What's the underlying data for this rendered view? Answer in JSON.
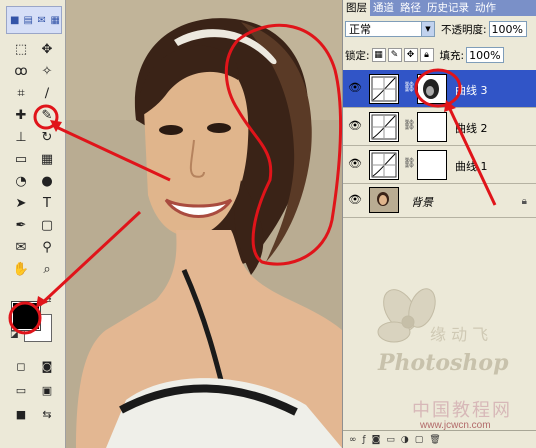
{
  "toolbar": {
    "top_icons": [
      "save-icon",
      "print-icon",
      "email-icon",
      "browse-icon"
    ],
    "tools": [
      {
        "name": "marquee-tool-icon",
        "glyph": "⬚"
      },
      {
        "name": "move-tool-icon",
        "glyph": "✥"
      },
      {
        "name": "lasso-tool-icon",
        "glyph": "ꝏ"
      },
      {
        "name": "magic-wand-tool-icon",
        "glyph": "✧"
      },
      {
        "name": "crop-tool-icon",
        "glyph": "⌗"
      },
      {
        "name": "slice-tool-icon",
        "glyph": "∕"
      },
      {
        "name": "healing-brush-tool-icon",
        "glyph": "✚"
      },
      {
        "name": "brush-tool-icon",
        "glyph": "✎"
      },
      {
        "name": "clone-stamp-tool-icon",
        "glyph": "⊥"
      },
      {
        "name": "history-brush-tool-icon",
        "glyph": "↻"
      },
      {
        "name": "eraser-tool-icon",
        "glyph": "▭"
      },
      {
        "name": "gradient-tool-icon",
        "glyph": "▦"
      },
      {
        "name": "blur-tool-icon",
        "glyph": "◔"
      },
      {
        "name": "dodge-tool-icon",
        "glyph": "●"
      },
      {
        "name": "path-selection-tool-icon",
        "glyph": "➤"
      },
      {
        "name": "type-tool-icon",
        "glyph": "T"
      },
      {
        "name": "pen-tool-icon",
        "glyph": "✒"
      },
      {
        "name": "shape-tool-icon",
        "glyph": "▢"
      },
      {
        "name": "notes-tool-icon",
        "glyph": "✉"
      },
      {
        "name": "eyedropper-tool-icon",
        "glyph": "⚲"
      },
      {
        "name": "hand-tool-icon",
        "glyph": "✋"
      },
      {
        "name": "zoom-tool-icon",
        "glyph": "⌕"
      }
    ],
    "bottom_tools": [
      {
        "name": "standard-mode-icon",
        "glyph": "◻"
      },
      {
        "name": "quick-mask-icon",
        "glyph": "◙"
      },
      {
        "name": "screen-mode-standard-icon",
        "glyph": "▭"
      },
      {
        "name": "screen-mode-menu-icon",
        "glyph": "▣"
      },
      {
        "name": "screen-mode-full-icon",
        "glyph": "■"
      },
      {
        "name": "jump-to-imageready-icon",
        "glyph": "⇆"
      }
    ]
  },
  "panel": {
    "tabs": [
      "图层",
      "通道",
      "路径",
      "历史记录",
      "动作"
    ],
    "blend_mode": "正常",
    "opacity_label": "不透明度:",
    "opacity_value": "100%",
    "lock_label": "锁定:",
    "fill_label": "填充:",
    "fill_value": "100%",
    "layers": [
      {
        "name": "曲线 3",
        "active": true
      },
      {
        "name": "曲线 2",
        "active": false
      },
      {
        "name": "曲线 1",
        "active": false
      },
      {
        "name": "背景",
        "active": false
      }
    ]
  },
  "watermark": {
    "brand": "Photoshop",
    "cn_text": "中国教程网",
    "site": "www.jcwcn.com"
  },
  "colors": {
    "accent": "#3155c7",
    "annotation": "#e0141a"
  }
}
